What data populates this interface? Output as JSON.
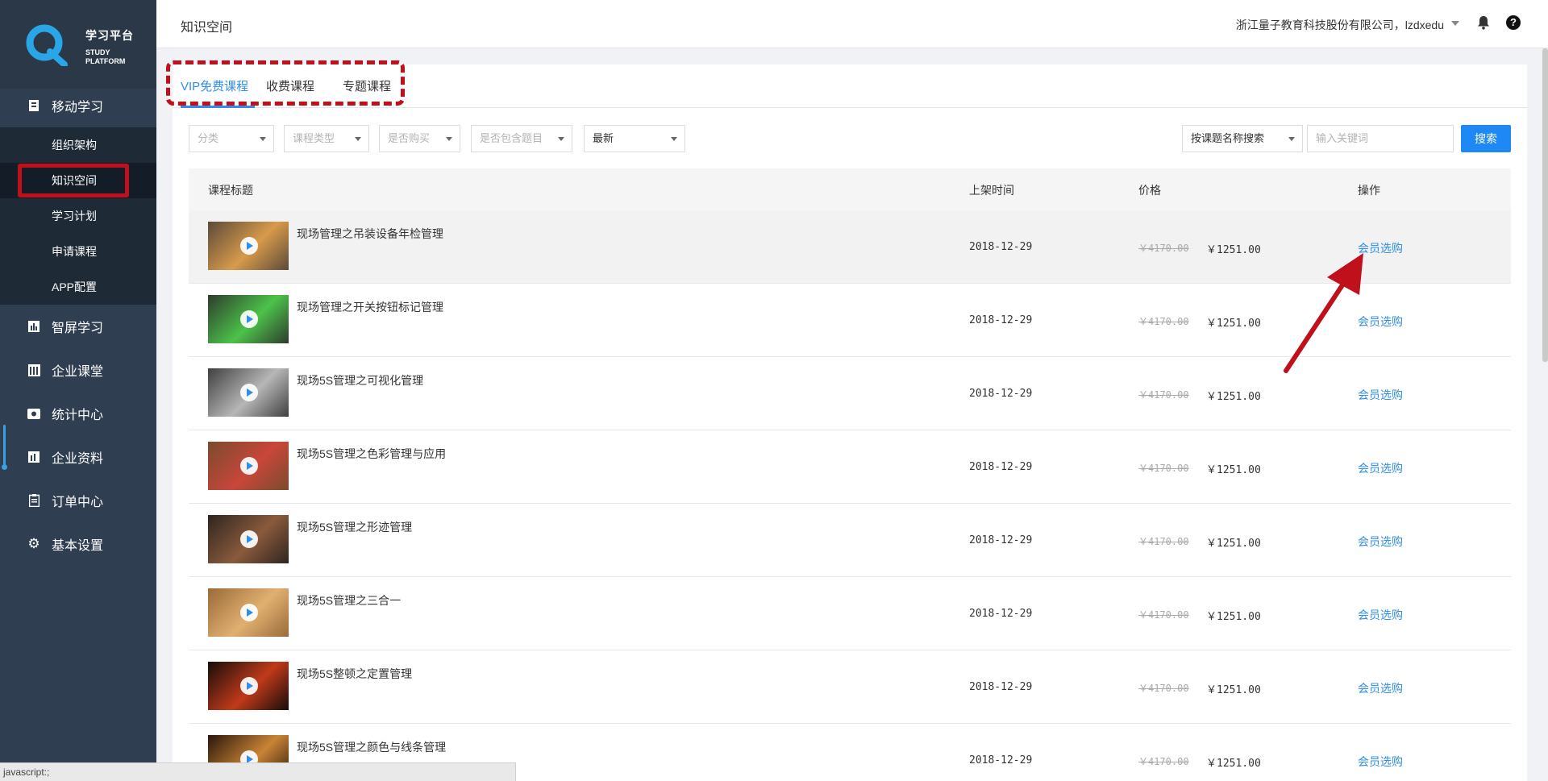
{
  "logo": {
    "cn": "学习平台",
    "en_line1": "STUDY",
    "en_line2": "PLATFORM"
  },
  "sidebar": {
    "groups": [
      {
        "label": "移动学习",
        "icon": "mobile-study-icon",
        "sub": [
          "组织架构",
          "知识空间",
          "学习计划",
          "申请课程",
          "APP配置"
        ],
        "active_sub": 1
      },
      {
        "label": "智屏学习",
        "icon": "bar-chart-icon"
      },
      {
        "label": "企业课堂",
        "icon": "classroom-icon"
      },
      {
        "label": "统计中心",
        "icon": "stats-icon"
      },
      {
        "label": "企业资料",
        "icon": "documents-icon"
      },
      {
        "label": "订单中心",
        "icon": "clipboard-icon"
      },
      {
        "label": "基本设置",
        "icon": "gear-icon"
      }
    ]
  },
  "header": {
    "title": "知识空间",
    "company": "浙江量子教育科技股份有限公司，lzdxedu",
    "help": "?"
  },
  "tabs": [
    "VIP免费课程",
    "收费课程",
    "专题课程"
  ],
  "filters": {
    "category": "分类",
    "course_type": "课程类型",
    "purchased": "是否购买",
    "has_questions": "是否包含题目",
    "sort": "最新",
    "search_mode": "按课题名称搜索",
    "keyword_placeholder": "输入关键词",
    "search_button": "搜索"
  },
  "table": {
    "headers": {
      "title": "课程标题",
      "date": "上架时间",
      "price": "价格",
      "action": "操作"
    },
    "rows": [
      {
        "title": "现场管理之吊装设备年检管理",
        "date": "2018-12-29",
        "old_price": "￥4170.00",
        "price": "￥1251.00",
        "action": "会员选购",
        "thumb": [
          "#5b4a3a",
          "#d89a4b"
        ]
      },
      {
        "title": "现场管理之开关按钮标记管理",
        "date": "2018-12-29",
        "old_price": "￥4170.00",
        "price": "￥1251.00",
        "action": "会员选购",
        "thumb": [
          "#2e3b2d",
          "#4cc24a"
        ]
      },
      {
        "title": "现场5S管理之可视化管理",
        "date": "2018-12-29",
        "old_price": "￥4170.00",
        "price": "￥1251.00",
        "action": "会员选购",
        "thumb": [
          "#3f3f3f",
          "#b7b7b7"
        ]
      },
      {
        "title": "现场5S管理之色彩管理与应用",
        "date": "2018-12-29",
        "old_price": "￥4170.00",
        "price": "￥1251.00",
        "action": "会员选购",
        "thumb": [
          "#7a4b2f",
          "#c9463a"
        ]
      },
      {
        "title": "现场5S管理之形迹管理",
        "date": "2018-12-29",
        "old_price": "￥4170.00",
        "price": "￥1251.00",
        "action": "会员选购",
        "thumb": [
          "#2e2520",
          "#8a5a3c"
        ]
      },
      {
        "title": "现场5S管理之三合一",
        "date": "2018-12-29",
        "old_price": "￥4170.00",
        "price": "￥1251.00",
        "action": "会员选购",
        "thumb": [
          "#9a6a3a",
          "#e0b070"
        ]
      },
      {
        "title": "现场5S整顿之定置管理",
        "date": "2018-12-29",
        "old_price": "￥4170.00",
        "price": "￥1251.00",
        "action": "会员选购",
        "thumb": [
          "#150d0a",
          "#c03a1a"
        ]
      },
      {
        "title": "现场5S管理之颜色与线条管理",
        "date": "2018-12-29",
        "old_price": "￥4170.00",
        "price": "￥1251.00",
        "action": "会员选购",
        "thumb": [
          "#2a160c",
          "#c98435"
        ]
      }
    ]
  },
  "status_bar": "javascript:;",
  "colors": {
    "accent": "#2f8ee8",
    "highlight": "#c0101b",
    "sidebar": "#2f3e50"
  }
}
